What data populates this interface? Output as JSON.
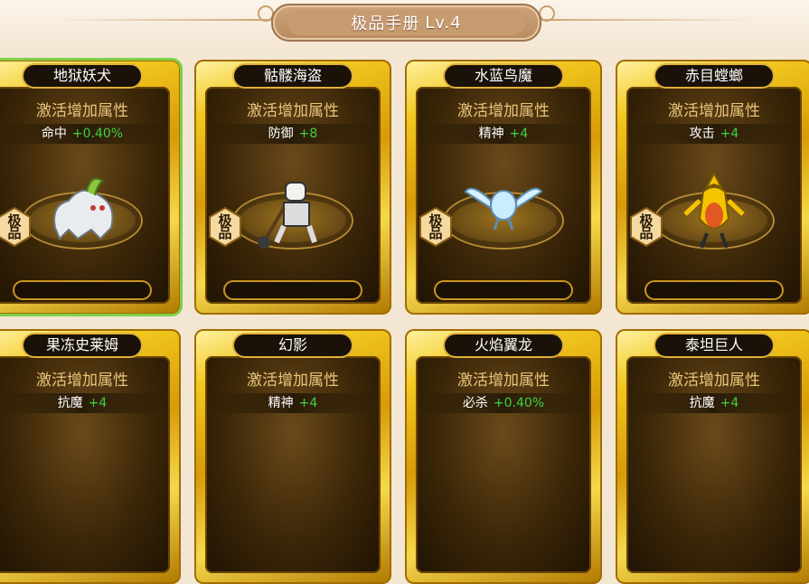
{
  "title": {
    "text": "极品手册",
    "level": "Lv.4"
  },
  "activate_label": "激活增加属性",
  "badge_label": "极品",
  "cards": [
    {
      "name": "地狱妖犬",
      "attr": "命中",
      "value": "+0.40%",
      "monster": "white-beast",
      "selected": true
    },
    {
      "name": "骷髅海盗",
      "attr": "防御",
      "value": "+8",
      "monster": "skeleton",
      "selected": false
    },
    {
      "name": "水蓝鸟魔",
      "attr": "精神",
      "value": "+4",
      "monster": "blue-bird",
      "selected": false
    },
    {
      "name": "赤目螳螂",
      "attr": "攻击",
      "value": "+4",
      "monster": "yellow-mantis",
      "selected": false
    },
    {
      "name": "果冻史莱姆",
      "attr": "抗魔",
      "value": "+4",
      "monster": "none",
      "selected": false
    },
    {
      "name": "幻影",
      "attr": "精神",
      "value": "+4",
      "monster": "none",
      "selected": false
    },
    {
      "name": "火焰翼龙",
      "attr": "必杀",
      "value": "+0.40%",
      "monster": "none",
      "selected": false
    },
    {
      "name": "泰坦巨人",
      "attr": "抗魔",
      "value": "+4",
      "monster": "none",
      "selected": false
    }
  ]
}
